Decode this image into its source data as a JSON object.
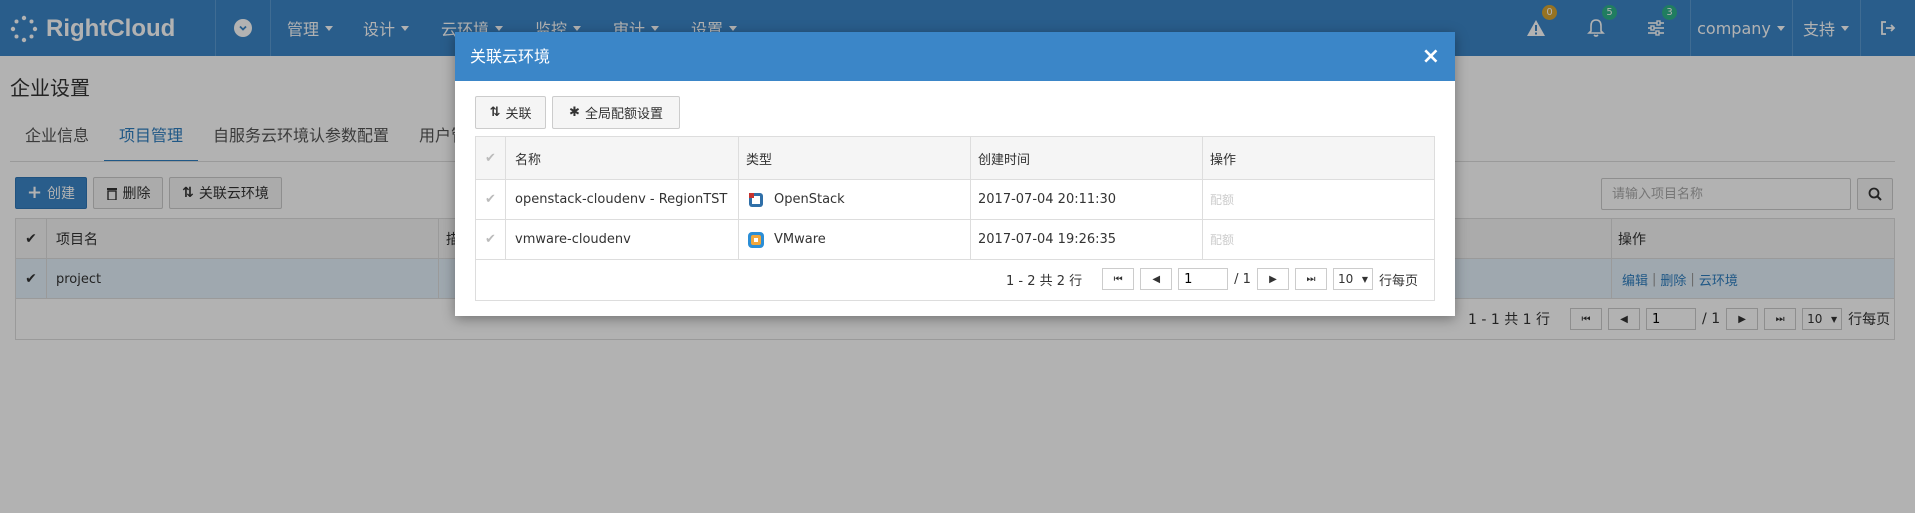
{
  "topbar": {
    "brand": "RightCloud",
    "nav": [
      "管理",
      "设计",
      "云环境",
      "监控",
      "审计",
      "设置"
    ],
    "badges": {
      "alerts": "0",
      "notifications": "5",
      "tasks": "3"
    },
    "company": "company",
    "support": "支持"
  },
  "page": {
    "title": "企业设置",
    "tabs": [
      "企业信息",
      "项目管理",
      "自服务云环境认参数配置",
      "用户管"
    ],
    "buttons": {
      "create": "创建",
      "delete": "删除",
      "link_env": "关联云环境"
    },
    "search_placeholder": "请输入项目名称",
    "table": {
      "headers": {
        "name": "项目名",
        "desc": "描",
        "ops": "操作"
      },
      "rows": [
        {
          "name": "project",
          "ops": [
            "编辑",
            "删除",
            "云环境"
          ]
        }
      ]
    },
    "pager": {
      "summary": "1 - 1 共 1 行",
      "page": "1",
      "total": "/ 1",
      "size": "10",
      "per_page": "行每页"
    }
  },
  "modal": {
    "title": "关联云环境",
    "close": "×",
    "buttons": {
      "link": "关联",
      "quota": "全局配额设置"
    },
    "headers": {
      "name": "名称",
      "type": "类型",
      "created": "创建时间",
      "ops": "操作"
    },
    "rows": [
      {
        "name": "openstack-cloudenv - RegionTST",
        "type": "OpenStack",
        "created": "2017-07-04 20:11:30",
        "op": "配额"
      },
      {
        "name": "vmware-cloudenv",
        "type": "VMware",
        "created": "2017-07-04 19:26:35",
        "op": "配额"
      }
    ],
    "pager": {
      "summary": "1 - 2 共 2 行",
      "page": "1",
      "total": "/ 1",
      "size": "10",
      "per_page": "行每页"
    }
  },
  "colors": {
    "primary": "#3b86c8",
    "link": "#2f7fc0",
    "badge_alert": "#d8a531",
    "badge_green": "#2fb38a"
  }
}
